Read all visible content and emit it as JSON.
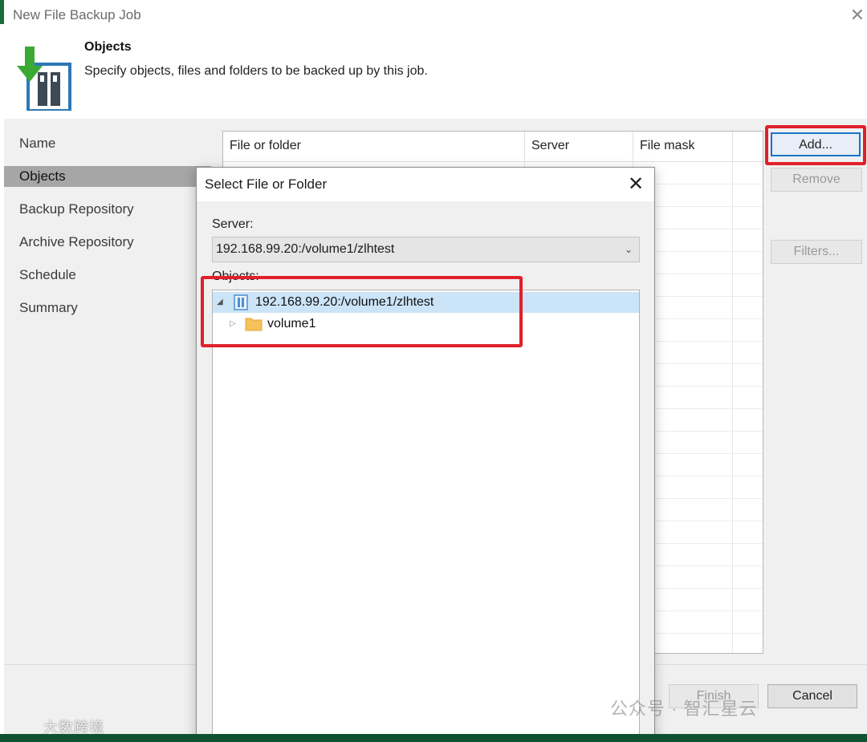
{
  "window": {
    "title": "New File Backup Job",
    "close_glyph": "✕"
  },
  "header": {
    "title": "Objects",
    "description": "Specify objects, files and folders to be backed up by this job."
  },
  "nav": {
    "items": [
      "Name",
      "Objects",
      "Backup Repository",
      "Archive Repository",
      "Schedule",
      "Summary"
    ],
    "active_index": 1
  },
  "grid": {
    "columns": [
      "File or folder",
      "Server",
      "File mask"
    ]
  },
  "buttons": {
    "add": "Add...",
    "remove": "Remove",
    "filters": "Filters...",
    "finish": "Finish",
    "cancel": "Cancel"
  },
  "dialog": {
    "title": "Select File or Folder",
    "close_glyph": "✕",
    "server_label": "Server:",
    "server_value": "192.168.99.20:/volume1/zlhtest",
    "objects_label": "Objects:",
    "tree": [
      {
        "label": "192.168.99.20:/volume1/zlhtest",
        "icon": "server-icon",
        "expanded": true,
        "selected": true
      },
      {
        "label": "volume1",
        "icon": "folder-icon",
        "expanded": false,
        "selected": false
      }
    ]
  },
  "watermarks": {
    "right": "公众号 · 智汇星云",
    "left": "大数跨境"
  },
  "colors": {
    "highlight": "#e0202a",
    "selection": "#cce4f7",
    "folder": "#f5c15a",
    "accent": "#1a73c8"
  }
}
